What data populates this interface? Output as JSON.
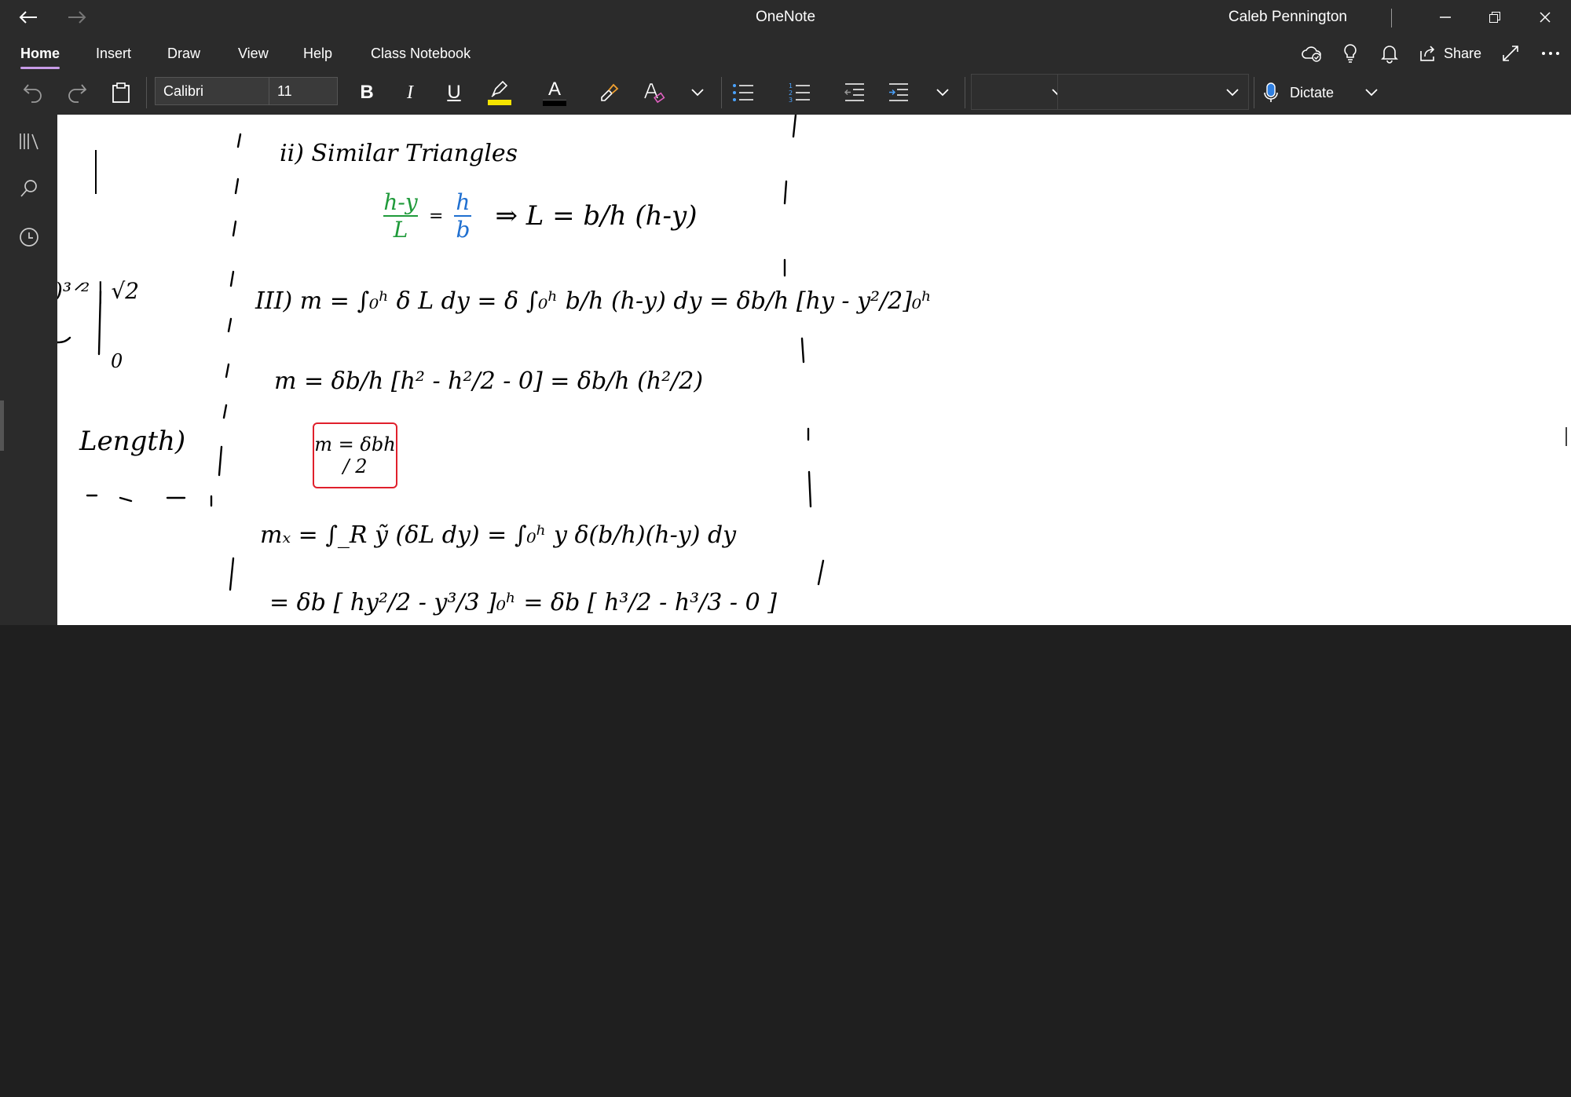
{
  "window": {
    "title": "OneNote",
    "user": "Caleb Pennington"
  },
  "header": {
    "share_label": "Share"
  },
  "tabs": [
    {
      "label": "Home",
      "active": true
    },
    {
      "label": "Insert"
    },
    {
      "label": "Draw"
    },
    {
      "label": "View"
    },
    {
      "label": "Help"
    },
    {
      "label": "Class Notebook"
    }
  ],
  "toolbar": {
    "font_name": "Calibri",
    "font_size": "11",
    "bold_label": "B",
    "italic_label": "I",
    "underline_label": "U",
    "font_color_label": "A",
    "dictate_label": "Dictate",
    "highlight_color": "#f5e400",
    "font_color": "#000000"
  },
  "colors": {
    "chrome": "#2b2b2b",
    "tab_indicator": "#c89ce8",
    "canvas": "#ffffff",
    "ink_black": "#000000",
    "ink_green": "#1f9a3a",
    "ink_blue": "#1f6fd0",
    "ink_red": "#e0202c"
  },
  "notes": {
    "similar_triangles": "ii) Similar Triangles",
    "eq_ratio_left_num": "h-y",
    "eq_ratio_left_den": "L",
    "eq_ratio_right_num": "h",
    "eq_ratio_right_den": "b",
    "eq_L": "⇒ L = b/h (h-y)",
    "step3": "III) m = ∫₀ʰ δ L dy = δ ∫₀ʰ b/h (h-y) dy = δb/h [hy - y²/2]₀ʰ",
    "step3b": "m = δb/h [h² - h²/2 - 0] = δb/h (h²/2)",
    "boxed": "m = δbh / 2",
    "mx": "mₓ = ∫_R ỹ (δL dy) = ∫₀ʰ y δ(b/h)(h-y) dy",
    "mx2": "= δb [ hy²/2 - y³/3 ]₀ʰ = δb [ h³/2 - h³/3 - 0 ]",
    "left_frag1": ")³ᐟ² | √2",
    "left_frag2": "0",
    "left_frag3": "Length)"
  }
}
